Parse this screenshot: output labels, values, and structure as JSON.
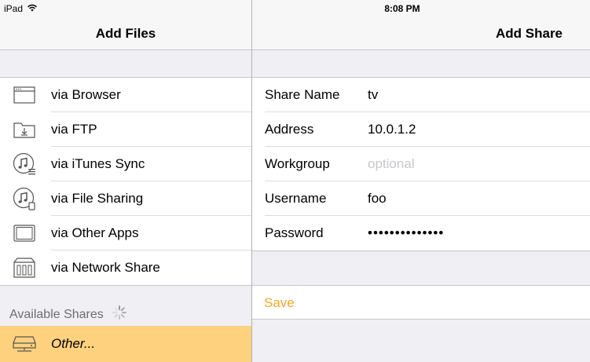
{
  "status_bar": {
    "device": "iPad",
    "time": "8:08 PM"
  },
  "left_pane": {
    "title": "Add Files",
    "items": [
      {
        "icon": "browser-window-icon",
        "label": "via Browser"
      },
      {
        "icon": "folder-download-icon",
        "label": "via FTP"
      },
      {
        "icon": "music-note-list-icon",
        "label": "via iTunes Sync"
      },
      {
        "icon": "music-note-device-icon",
        "label": "via File Sharing"
      },
      {
        "icon": "tablet-icon",
        "label": "via Other Apps"
      },
      {
        "icon": "network-drive-icon",
        "label": "via Network Share"
      }
    ],
    "section_header": "Available Shares",
    "selected_item": {
      "icon": "hard-drive-icon",
      "label": "Other...",
      "highlight_color": "#fdd17d"
    }
  },
  "right_pane": {
    "title": "Add Share",
    "fields": [
      {
        "label": "Share Name",
        "value": "tv",
        "placeholder": ""
      },
      {
        "label": "Address",
        "value": "10.0.1.2",
        "placeholder": ""
      },
      {
        "label": "Workgroup",
        "value": "",
        "placeholder": "optional"
      },
      {
        "label": "Username",
        "value": "foo",
        "placeholder": ""
      },
      {
        "label": "Password",
        "value": "••••••••••••••",
        "placeholder": ""
      }
    ],
    "save_label": "Save",
    "accent_color": "#f5a623"
  }
}
